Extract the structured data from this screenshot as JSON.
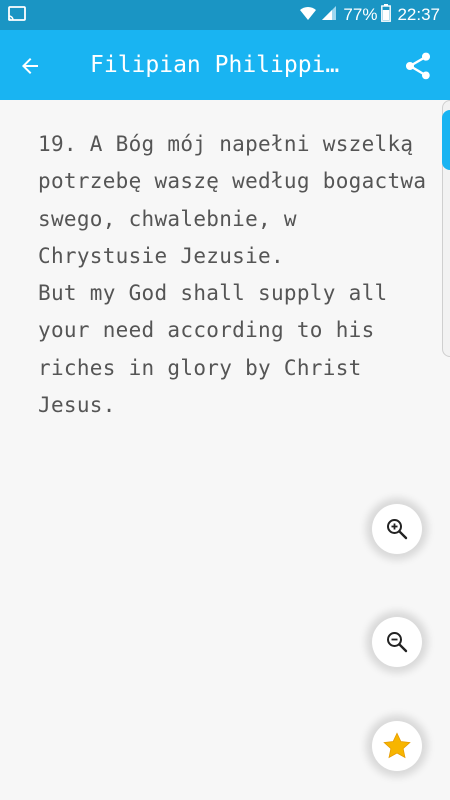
{
  "status_bar": {
    "battery_percent": "77%",
    "time": "22:37",
    "icons": [
      "cast-icon",
      "wifi-icon",
      "signal-icon",
      "battery-icon"
    ]
  },
  "app_bar": {
    "title": "Filipian Philippi…",
    "back_icon": "arrow-left-icon",
    "share_icon": "share-icon",
    "color": "#19b4f2"
  },
  "verse": {
    "polish": "19. A Bóg mój napełni wszelką potrzebę waszę według bogactwa swego, chwalebnie, w Chrystusie Jezusie.",
    "english": "But my God shall supply all your need according to his riches in glory by Christ Jesus."
  },
  "fabs": [
    {
      "name": "zoom-in-button",
      "icon": "zoom-in-icon"
    },
    {
      "name": "zoom-out-button",
      "icon": "zoom-out-icon"
    },
    {
      "name": "favorite-button",
      "icon": "star-icon"
    }
  ]
}
